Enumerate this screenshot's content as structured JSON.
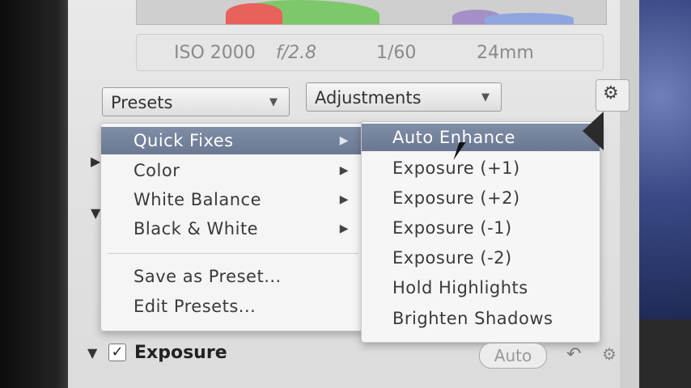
{
  "histogram": {
    "colors": {
      "red": "#e8615a",
      "green": "#7ec86c",
      "blue": "#8fa6dc"
    }
  },
  "exif": {
    "iso": "ISO 2000",
    "aperture": "f/2.8",
    "shutter": "1/60",
    "focal": "24mm"
  },
  "toolbar": {
    "presets_label": "Presets",
    "adjustments_label": "Adjustments"
  },
  "menu": {
    "items": [
      {
        "label": "Quick Fixes",
        "submenu": "▶"
      },
      {
        "label": "Color",
        "submenu": "▶"
      },
      {
        "label": "White Balance",
        "submenu": "▶"
      },
      {
        "label": "Black & White",
        "submenu": "▶"
      },
      {
        "label": "Save as Preset..."
      },
      {
        "label": "Edit Presets..."
      }
    ]
  },
  "submenu": {
    "items": [
      {
        "label": "Auto Enhance"
      },
      {
        "label": "Exposure (+1)"
      },
      {
        "label": "Exposure (+2)"
      },
      {
        "label": "Exposure (-1)"
      },
      {
        "label": "Exposure (-2)"
      },
      {
        "label": "Hold Highlights"
      },
      {
        "label": "Brighten Shadows"
      }
    ]
  },
  "exposure": {
    "label": "Exposure",
    "checked": "✓",
    "auto_label": "Auto"
  },
  "accent_color": "#6a7891"
}
